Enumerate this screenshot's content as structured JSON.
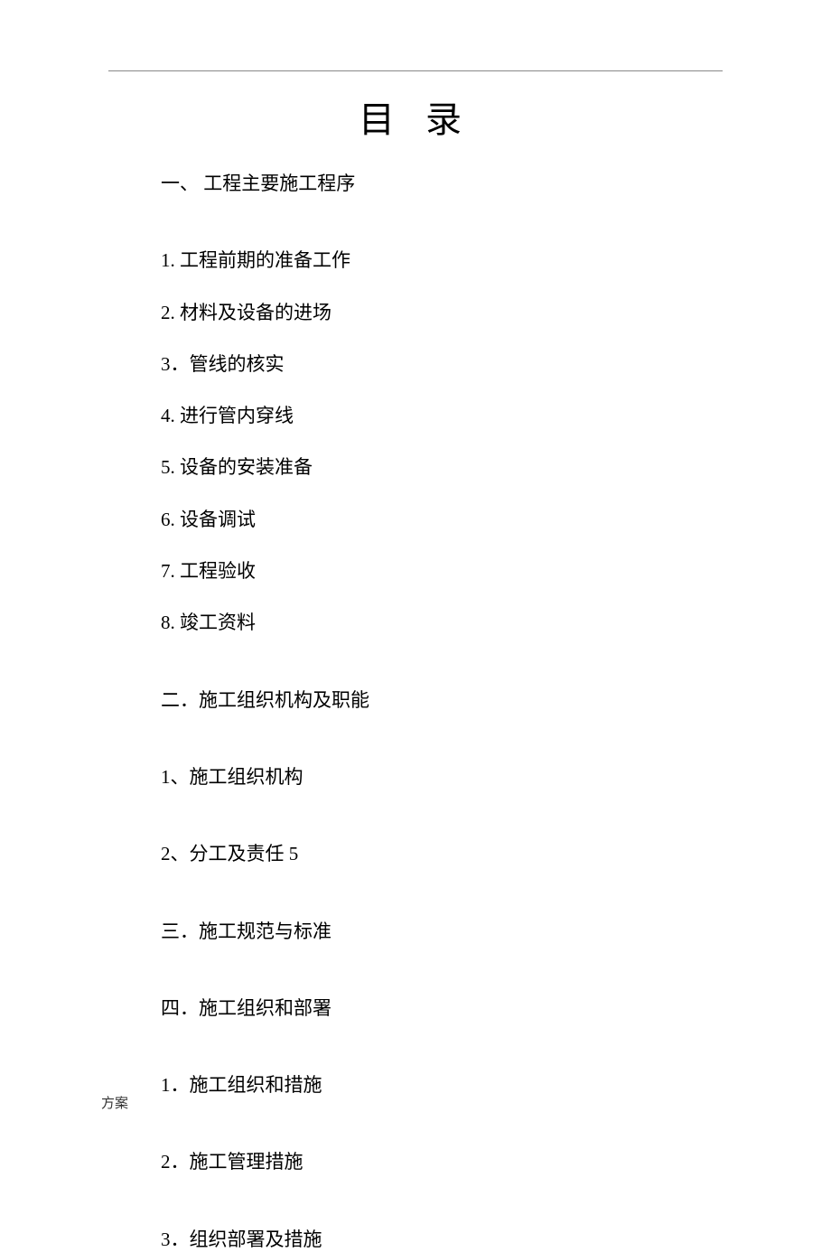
{
  "title": "目 录",
  "lines": [
    {
      "text": "一、 工程主要施工程序",
      "gap": "first"
    },
    {
      "text": "1. 工程前期的准备工作",
      "gap": "large"
    },
    {
      "text": "2. 材料及设备的进场",
      "gap": "small"
    },
    {
      "text": "3．管线的核实",
      "gap": "small"
    },
    {
      "text": "4. 进行管内穿线",
      "gap": "small"
    },
    {
      "text": "5. 设备的安装准备",
      "gap": "small"
    },
    {
      "text": "6. 设备调试",
      "gap": "small"
    },
    {
      "text": "7. 工程验收",
      "gap": "small"
    },
    {
      "text": "8. 竣工资料",
      "gap": "small"
    },
    {
      "text": "二．施工组织机构及职能",
      "gap": "large"
    },
    {
      "text": "1、施工组织机构",
      "gap": "large"
    },
    {
      "text": "2、分工及责任 5",
      "gap": "large"
    },
    {
      "text": "三．施工规范与标准",
      "gap": "large"
    },
    {
      "text": "四．施工组织和部署",
      "gap": "large"
    },
    {
      "text": "1．施工组织和措施",
      "gap": "large"
    },
    {
      "text": "2．施工管理措施",
      "gap": "large"
    },
    {
      "text": "3．组织部署及措施",
      "gap": "large"
    }
  ],
  "footer": "方案"
}
